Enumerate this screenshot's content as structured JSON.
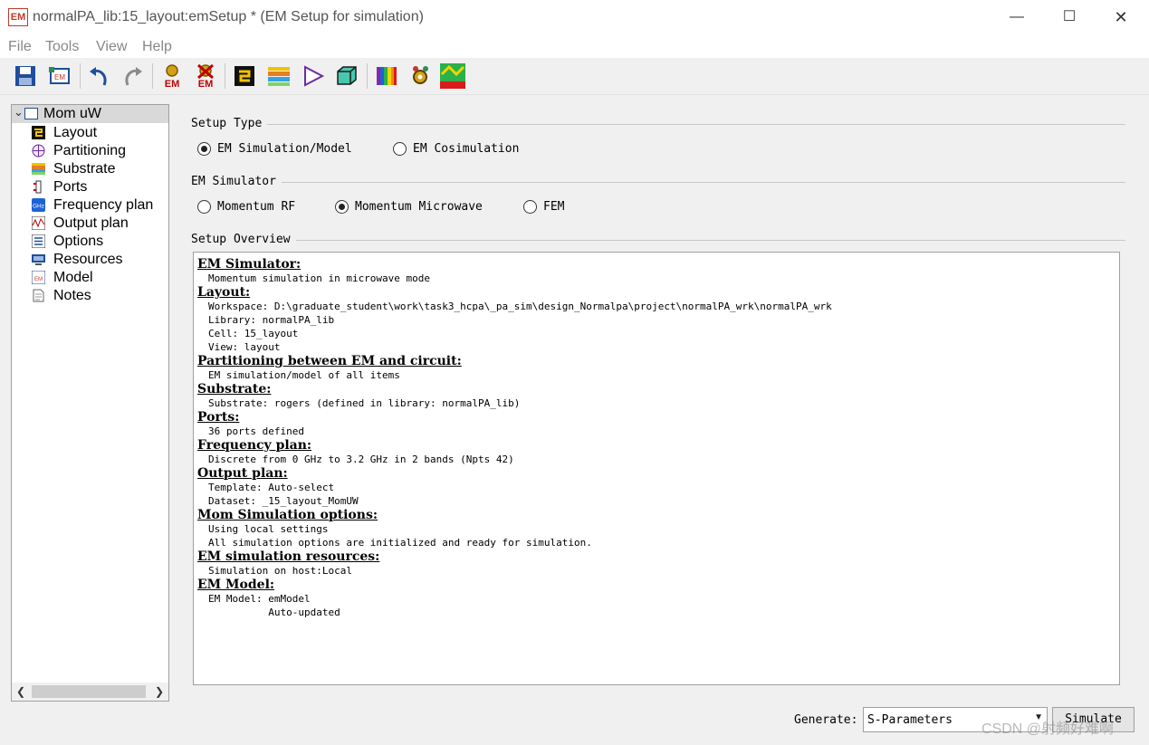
{
  "window": {
    "app_icon": "EM",
    "title": "normalPA_lib:15_layout:emSetup * (EM Setup for simulation)"
  },
  "menu": [
    "File",
    "Tools",
    "View",
    "Help"
  ],
  "toolbar": {
    "icons": [
      "save-icon",
      "em-model-icon",
      "undo-icon",
      "redo-icon",
      "em-simulate-icon",
      "em-stop-icon",
      "layout-icon",
      "substrate-icon",
      "ports-icon",
      "3d-view-icon",
      "color-map-icon",
      "optimize-icon",
      "visualization-icon"
    ]
  },
  "tree": {
    "root": "Mom uW",
    "items": [
      "Layout",
      "Partitioning",
      "Substrate",
      "Ports",
      "Frequency plan",
      "Output plan",
      "Options",
      "Resources",
      "Model",
      "Notes"
    ]
  },
  "setup_type": {
    "label": "Setup Type",
    "options": [
      "EM Simulation/Model",
      "EM Cosimulation"
    ],
    "selected": "EM Simulation/Model"
  },
  "em_simulator": {
    "label": "EM Simulator",
    "options": [
      "Momentum RF",
      "Momentum Microwave",
      "FEM"
    ],
    "selected": "Momentum Microwave"
  },
  "overview": {
    "label": "Setup Overview",
    "sections": [
      {
        "heading": "EM Simulator:",
        "lines": [
          "Momentum simulation in microwave mode"
        ]
      },
      {
        "heading": "Layout:",
        "lines": [
          "Workspace: D:\\graduate_student\\work\\task3_hcpa\\_pa_sim\\design_Normalpa\\project\\normalPA_wrk\\normalPA_wrk",
          "Library: normalPA_lib",
          "Cell: 15_layout",
          "View: layout"
        ]
      },
      {
        "heading": "Partitioning between EM and circuit:",
        "lines": [
          "EM simulation/model of all items"
        ]
      },
      {
        "heading": "Substrate:",
        "lines": [
          "Substrate: rogers (defined in library: normalPA_lib)"
        ]
      },
      {
        "heading": "Ports:",
        "lines": [
          "36 ports defined"
        ]
      },
      {
        "heading": "Frequency plan:",
        "lines": [
          "Discrete from 0 GHz to 3.2 GHz in 2 bands (Npts 42)"
        ]
      },
      {
        "heading": "Output plan:",
        "lines": [
          "Template: Auto-select",
          "Dataset: _15_layout_MomUW"
        ]
      },
      {
        "heading": "Mom Simulation options:",
        "lines": [
          "Using local settings",
          "All simulation options are initialized and ready for simulation."
        ]
      },
      {
        "heading": "EM simulation resources:",
        "lines": [
          "Simulation on host:Local"
        ]
      },
      {
        "heading": "EM Model:",
        "lines": [
          "EM Model: emModel",
          "          Auto-updated"
        ]
      }
    ]
  },
  "generate": {
    "label": "Generate:",
    "value": "S-Parameters",
    "simulate_label": "Simulate"
  },
  "watermark": "CSDN @射频好难啊"
}
